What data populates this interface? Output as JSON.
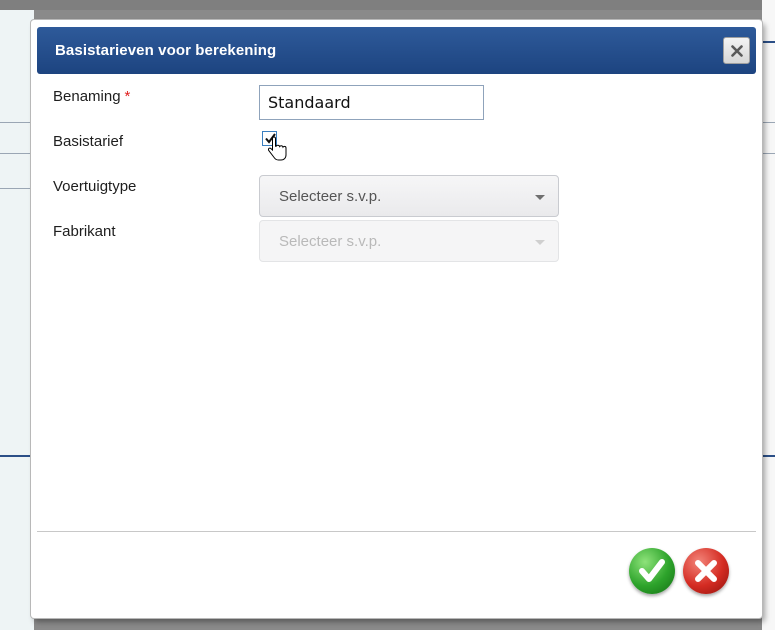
{
  "dialog": {
    "title": "Basistarieven voor berekening",
    "close_icon": "close-icon"
  },
  "form": {
    "benaming": {
      "label": "Benaming",
      "required_marker": "*",
      "value": "Standaard"
    },
    "basistarief": {
      "label": "Basistarief",
      "checked": true
    },
    "voertuigtype": {
      "label": "Voertuigtype",
      "selected": "Selecteer s.v.p.",
      "enabled": true
    },
    "fabrikant": {
      "label": "Fabrikant",
      "selected": "Selecteer s.v.p.",
      "enabled": false
    }
  },
  "actions": {
    "confirm_icon": "check-icon",
    "cancel_icon": "x-icon"
  },
  "colors": {
    "titlebar": "#1d4480",
    "confirm": "#2da32b",
    "cancel": "#d42b22",
    "required": "#e02020"
  }
}
